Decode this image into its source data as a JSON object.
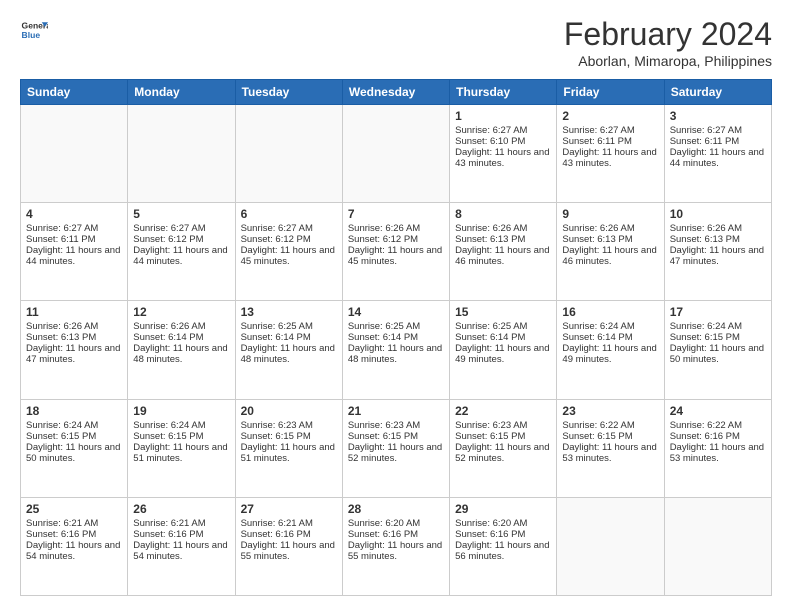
{
  "header": {
    "logo_general": "General",
    "logo_blue": "Blue",
    "title": "February 2024",
    "subtitle": "Aborlan, Mimaropa, Philippines"
  },
  "days_of_week": [
    "Sunday",
    "Monday",
    "Tuesday",
    "Wednesday",
    "Thursday",
    "Friday",
    "Saturday"
  ],
  "weeks": [
    [
      {
        "day": "",
        "info": ""
      },
      {
        "day": "",
        "info": ""
      },
      {
        "day": "",
        "info": ""
      },
      {
        "day": "",
        "info": ""
      },
      {
        "day": "1",
        "info": "Sunrise: 6:27 AM\nSunset: 6:10 PM\nDaylight: 11 hours and 43 minutes."
      },
      {
        "day": "2",
        "info": "Sunrise: 6:27 AM\nSunset: 6:11 PM\nDaylight: 11 hours and 43 minutes."
      },
      {
        "day": "3",
        "info": "Sunrise: 6:27 AM\nSunset: 6:11 PM\nDaylight: 11 hours and 44 minutes."
      }
    ],
    [
      {
        "day": "4",
        "info": "Sunrise: 6:27 AM\nSunset: 6:11 PM\nDaylight: 11 hours and 44 minutes."
      },
      {
        "day": "5",
        "info": "Sunrise: 6:27 AM\nSunset: 6:12 PM\nDaylight: 11 hours and 44 minutes."
      },
      {
        "day": "6",
        "info": "Sunrise: 6:27 AM\nSunset: 6:12 PM\nDaylight: 11 hours and 45 minutes."
      },
      {
        "day": "7",
        "info": "Sunrise: 6:26 AM\nSunset: 6:12 PM\nDaylight: 11 hours and 45 minutes."
      },
      {
        "day": "8",
        "info": "Sunrise: 6:26 AM\nSunset: 6:13 PM\nDaylight: 11 hours and 46 minutes."
      },
      {
        "day": "9",
        "info": "Sunrise: 6:26 AM\nSunset: 6:13 PM\nDaylight: 11 hours and 46 minutes."
      },
      {
        "day": "10",
        "info": "Sunrise: 6:26 AM\nSunset: 6:13 PM\nDaylight: 11 hours and 47 minutes."
      }
    ],
    [
      {
        "day": "11",
        "info": "Sunrise: 6:26 AM\nSunset: 6:13 PM\nDaylight: 11 hours and 47 minutes."
      },
      {
        "day": "12",
        "info": "Sunrise: 6:26 AM\nSunset: 6:14 PM\nDaylight: 11 hours and 48 minutes."
      },
      {
        "day": "13",
        "info": "Sunrise: 6:25 AM\nSunset: 6:14 PM\nDaylight: 11 hours and 48 minutes."
      },
      {
        "day": "14",
        "info": "Sunrise: 6:25 AM\nSunset: 6:14 PM\nDaylight: 11 hours and 48 minutes."
      },
      {
        "day": "15",
        "info": "Sunrise: 6:25 AM\nSunset: 6:14 PM\nDaylight: 11 hours and 49 minutes."
      },
      {
        "day": "16",
        "info": "Sunrise: 6:24 AM\nSunset: 6:14 PM\nDaylight: 11 hours and 49 minutes."
      },
      {
        "day": "17",
        "info": "Sunrise: 6:24 AM\nSunset: 6:15 PM\nDaylight: 11 hours and 50 minutes."
      }
    ],
    [
      {
        "day": "18",
        "info": "Sunrise: 6:24 AM\nSunset: 6:15 PM\nDaylight: 11 hours and 50 minutes."
      },
      {
        "day": "19",
        "info": "Sunrise: 6:24 AM\nSunset: 6:15 PM\nDaylight: 11 hours and 51 minutes."
      },
      {
        "day": "20",
        "info": "Sunrise: 6:23 AM\nSunset: 6:15 PM\nDaylight: 11 hours and 51 minutes."
      },
      {
        "day": "21",
        "info": "Sunrise: 6:23 AM\nSunset: 6:15 PM\nDaylight: 11 hours and 52 minutes."
      },
      {
        "day": "22",
        "info": "Sunrise: 6:23 AM\nSunset: 6:15 PM\nDaylight: 11 hours and 52 minutes."
      },
      {
        "day": "23",
        "info": "Sunrise: 6:22 AM\nSunset: 6:15 PM\nDaylight: 11 hours and 53 minutes."
      },
      {
        "day": "24",
        "info": "Sunrise: 6:22 AM\nSunset: 6:16 PM\nDaylight: 11 hours and 53 minutes."
      }
    ],
    [
      {
        "day": "25",
        "info": "Sunrise: 6:21 AM\nSunset: 6:16 PM\nDaylight: 11 hours and 54 minutes."
      },
      {
        "day": "26",
        "info": "Sunrise: 6:21 AM\nSunset: 6:16 PM\nDaylight: 11 hours and 54 minutes."
      },
      {
        "day": "27",
        "info": "Sunrise: 6:21 AM\nSunset: 6:16 PM\nDaylight: 11 hours and 55 minutes."
      },
      {
        "day": "28",
        "info": "Sunrise: 6:20 AM\nSunset: 6:16 PM\nDaylight: 11 hours and 55 minutes."
      },
      {
        "day": "29",
        "info": "Sunrise: 6:20 AM\nSunset: 6:16 PM\nDaylight: 11 hours and 56 minutes."
      },
      {
        "day": "",
        "info": ""
      },
      {
        "day": "",
        "info": ""
      }
    ]
  ]
}
